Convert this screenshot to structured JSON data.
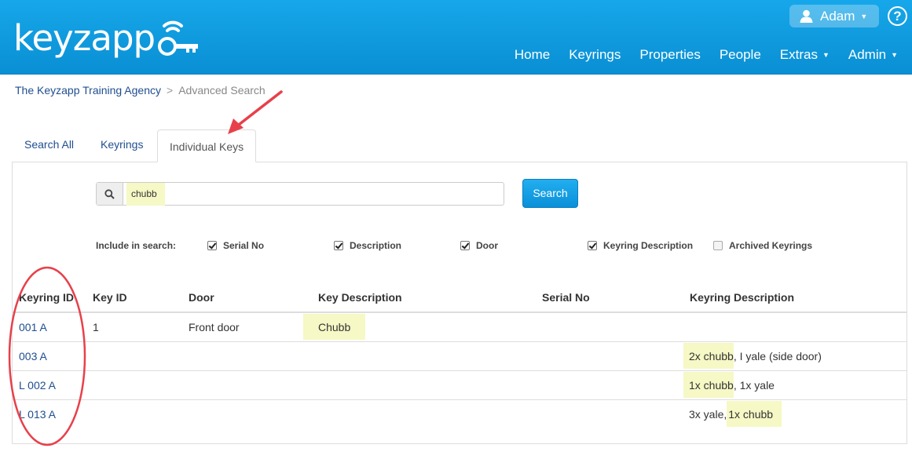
{
  "brand": {
    "name": "keyzapp"
  },
  "user": {
    "name": "Adam"
  },
  "help": {
    "label": "?"
  },
  "nav": {
    "home": "Home",
    "keyrings": "Keyrings",
    "properties": "Properties",
    "people": "People",
    "extras": "Extras",
    "admin": "Admin"
  },
  "breadcrumb": {
    "agency": "The Keyzapp Training Agency",
    "separator": ">",
    "current": "Advanced Search"
  },
  "tabs": [
    "Search All",
    "Keyrings",
    "Individual Keys"
  ],
  "active_tab": "Individual Keys",
  "search": {
    "value": "chubb",
    "button": "Search"
  },
  "include": {
    "label": "Include in search:",
    "options": [
      {
        "label": "Serial No",
        "checked": true
      },
      {
        "label": "Description",
        "checked": true
      },
      {
        "label": "Door",
        "checked": true
      },
      {
        "label": "Keyring Description",
        "checked": true
      },
      {
        "label": "Archived Keyrings",
        "checked": false
      }
    ]
  },
  "table": {
    "headers": [
      "Keyring ID",
      "Key ID",
      "Door",
      "Key Description",
      "Serial No",
      "Keyring Description"
    ],
    "rows": [
      {
        "keyring_id": "001 A",
        "key_id": "1",
        "door": "Front door",
        "key_description": "Chubb",
        "serial_no": "",
        "keyring_desc_pre": "",
        "keyring_desc_hl": "",
        "keyring_desc_post": ""
      },
      {
        "keyring_id": "003 A",
        "key_id": "",
        "door": "",
        "key_description": "",
        "serial_no": "",
        "keyring_desc_pre": "",
        "keyring_desc_hl": "2x chubb",
        "keyring_desc_post": ", I yale (side door)"
      },
      {
        "keyring_id": "L 002 A",
        "key_id": "",
        "door": "",
        "key_description": "",
        "serial_no": "",
        "keyring_desc_pre": "",
        "keyring_desc_hl": "1x chubb",
        "keyring_desc_post": ", 1x yale"
      },
      {
        "keyring_id": "L 013 A",
        "key_id": "",
        "door": "",
        "key_description": "",
        "serial_no": "",
        "keyring_desc_pre": "3x yale, ",
        "keyring_desc_hl": "1x chubb",
        "keyring_desc_post": ""
      }
    ]
  },
  "colors": {
    "header": "#0a9ae0",
    "link": "#1f4e8f",
    "highlight": "#f6f8c5",
    "annotation": "#e8404a"
  }
}
